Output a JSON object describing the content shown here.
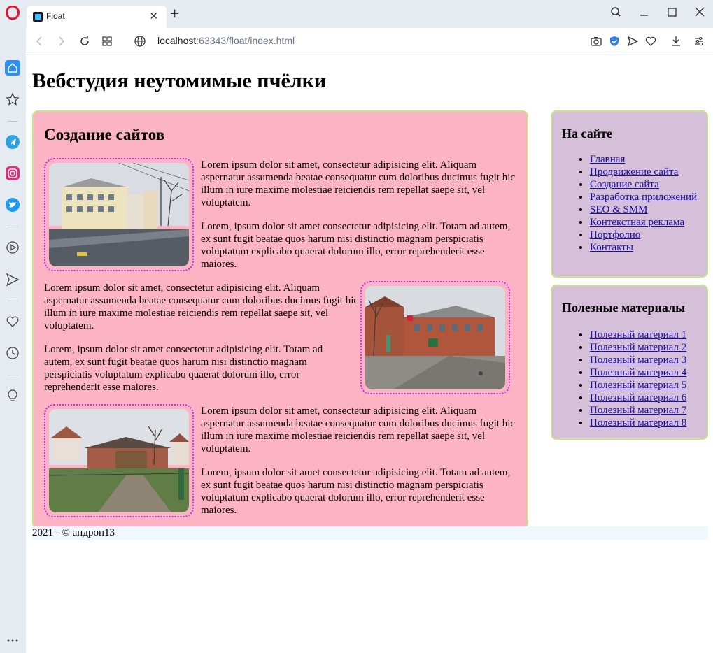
{
  "browser": {
    "tab_title": "Float",
    "url_host": "localhost",
    "url_rest": ":63343/float/index.html"
  },
  "page": {
    "site_title": "Вебстудия неутомимые пчёлки",
    "main_heading": "Создание сайтов",
    "paragraphs": [
      "Lorem ipsum dolor sit amet, consectetur adipisicing elit. Aliquam aspernatur assumenda beatae consequatur cum doloribus ducimus fugit hic illum in iure maxime molestiae reiciendis rem repellat saepe sit, vel voluptatem.",
      "Lorem, ipsum dolor sit amet consectetur adipisicing elit. Totam ad autem, ex sunt fugit beatae quos harum nisi distinctio magnam perspiciatis voluptatum explicabo quaerat dolorum illo, error reprehenderit esse maiores."
    ],
    "nav": {
      "title": "На сайте",
      "items": [
        "Главная",
        "Продвижение сайта",
        "Создание сайта",
        "Разработка приложений",
        "SEO & SMM",
        "Контекстная реклама",
        "Портфолио",
        "Контакты"
      ]
    },
    "materials": {
      "title": "Полезные материалы",
      "items": [
        "Полезный материал 1",
        "Полезный материал 2",
        "Полезный материал 3",
        "Полезный материал 4",
        "Полезный материал 5",
        "Полезный материал 6",
        "Полезный материал 7",
        "Полезный материал 8"
      ]
    },
    "footer": "2021 - © андрон13"
  },
  "colors": {
    "main_bg": "#fcb3c3",
    "side_bg": "#d6bfd9",
    "border": "#c7e48a",
    "photo_border": "#c030e8",
    "link": "#1a0dab",
    "footer_bg": "#f0f7ff"
  },
  "icons": {
    "sidebar": [
      "home-icon",
      "star-icon",
      "telegram-icon",
      "instagram-icon",
      "twitter-icon",
      "player-icon",
      "send-icon",
      "heart-icon",
      "history-icon",
      "lightbulb-icon",
      "more-icon"
    ],
    "toolbar": [
      "camera-icon",
      "shield-icon",
      "send-icon",
      "heart-icon",
      "download-icon",
      "settings-icon"
    ]
  }
}
